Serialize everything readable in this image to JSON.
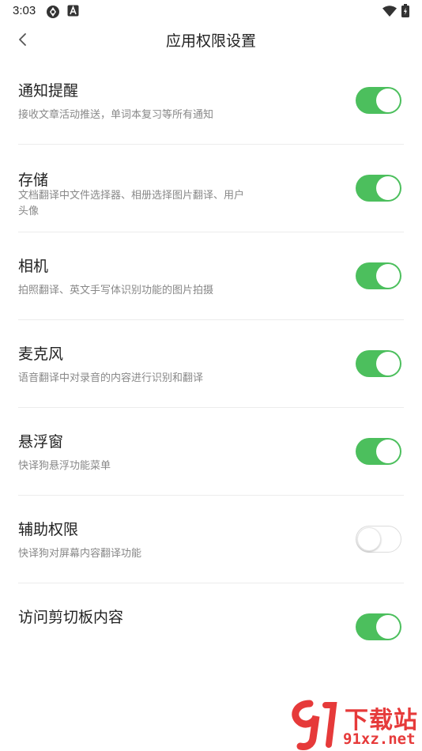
{
  "status_bar": {
    "time": "3:03"
  },
  "header": {
    "title": "应用权限设置"
  },
  "permissions": [
    {
      "title": "通知提醒",
      "description": "接收文章活动推送，单词本复习等所有通知",
      "enabled": true
    },
    {
      "title": "存储",
      "description": "文档翻译中文件选择器、相册选择图片翻译、用户头像",
      "enabled": true
    },
    {
      "title": "相机",
      "description": "拍照翻译、英文手写体识别功能的图片拍摄",
      "enabled": true
    },
    {
      "title": "麦克风",
      "description": "语音翻译中对录音的内容进行识别和翻译",
      "enabled": true
    },
    {
      "title": "悬浮窗",
      "description": "快译狗悬浮功能菜单",
      "enabled": true
    },
    {
      "title": "辅助权限",
      "description": "快译狗对屏幕内容翻译功能",
      "enabled": false
    },
    {
      "title": "访问剪切板内容",
      "description": "",
      "enabled": true
    }
  ],
  "watermark": {
    "text": "下载站",
    "url": "91xz.net"
  },
  "colors": {
    "toggle_on": "#4cbf5d",
    "toggle_off_border": "#dcdcdc"
  }
}
